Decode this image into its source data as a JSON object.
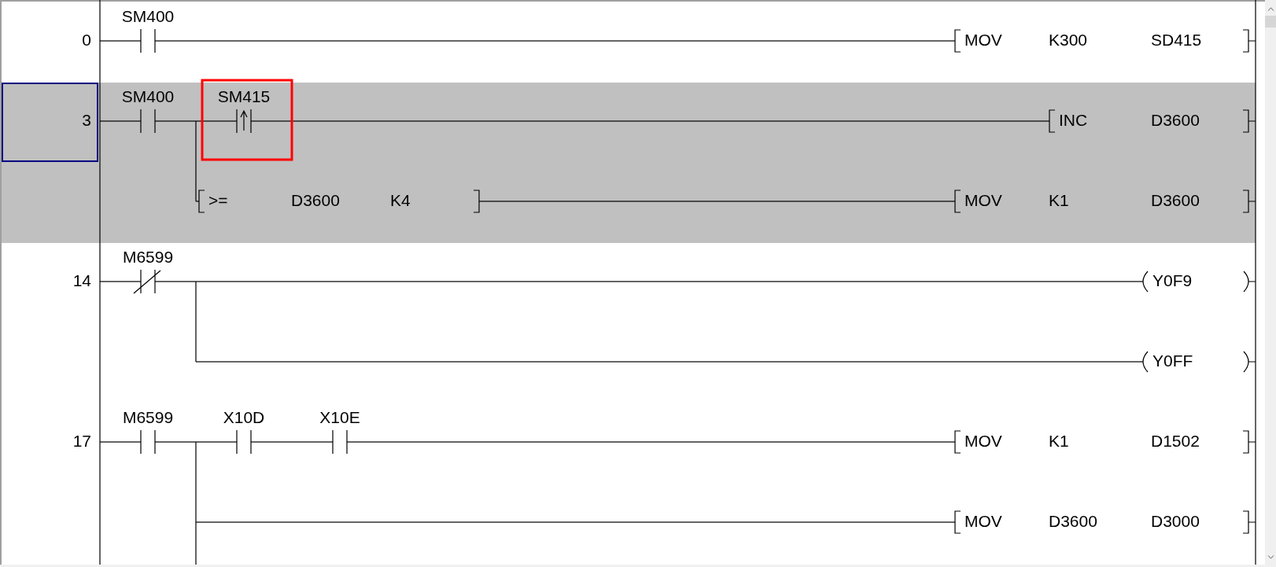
{
  "rungs": [
    {
      "step": "0",
      "selected": false,
      "lead": [
        {
          "kind": "open",
          "device": "SM400",
          "marked": false
        }
      ],
      "branches": [
        {
          "output": {
            "kind": "instruction",
            "parts": [
              "MOV",
              "K300",
              "SD415"
            ]
          }
        }
      ]
    },
    {
      "step": "3",
      "selected": true,
      "lead": [
        {
          "kind": "open",
          "device": "SM400",
          "marked": false
        }
      ],
      "branches": [
        {
          "inputs": [
            {
              "kind": "rising",
              "device": "SM415",
              "marked": true
            }
          ],
          "output": {
            "kind": "instruction",
            "parts": [
              "INC",
              "D3600"
            ]
          }
        },
        {
          "inputs": [
            {
              "kind": "compare",
              "operator": ">=",
              "operands": [
                "D3600",
                "K4"
              ],
              "marked": false
            }
          ],
          "output": {
            "kind": "instruction",
            "parts": [
              "MOV",
              "K1",
              "D3600"
            ]
          }
        }
      ]
    },
    {
      "step": "14",
      "selected": false,
      "lead": [
        {
          "kind": "closed",
          "device": "M6599",
          "marked": false
        }
      ],
      "branches": [
        {
          "output": {
            "kind": "coil",
            "parts": [
              "Y0F9"
            ]
          }
        },
        {
          "output": {
            "kind": "coil",
            "parts": [
              "Y0FF"
            ]
          }
        }
      ]
    },
    {
      "step": "17",
      "selected": false,
      "lead": [
        {
          "kind": "open",
          "device": "M6599",
          "marked": false
        }
      ],
      "branches": [
        {
          "inputs": [
            {
              "kind": "open",
              "device": "X10D",
              "marked": false
            },
            {
              "kind": "open",
              "device": "X10E",
              "marked": false
            }
          ],
          "output": {
            "kind": "instruction",
            "parts": [
              "MOV",
              "K1",
              "D1502"
            ]
          }
        },
        {
          "output": {
            "kind": "instruction",
            "parts": [
              "MOV",
              "D3600",
              "D3000"
            ]
          }
        }
      ]
    }
  ],
  "more_below": true
}
